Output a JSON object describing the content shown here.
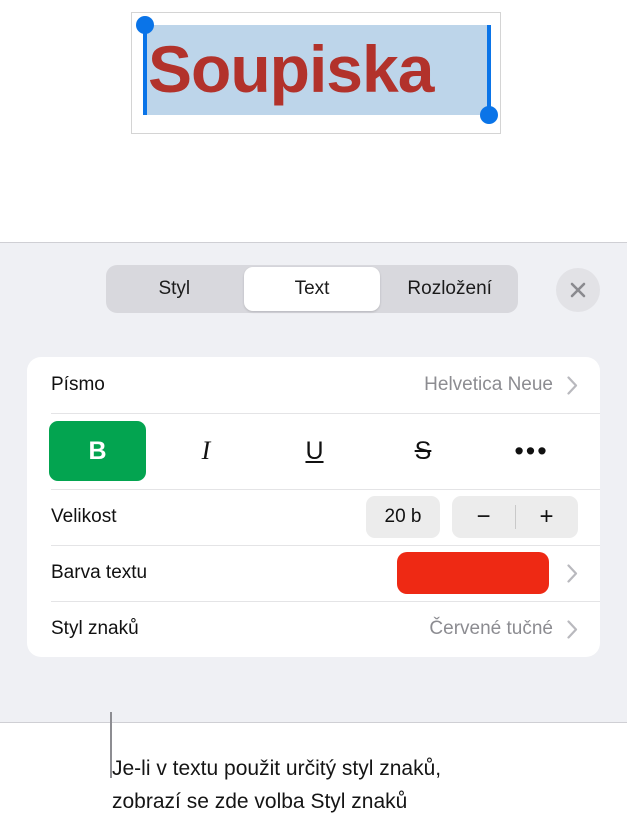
{
  "document": {
    "selected_text": "Soupiska",
    "text_color": "#b2322b",
    "selection_highlight": "#bdd5ea",
    "handle_color": "#0a74e8"
  },
  "panel": {
    "tabs": [
      {
        "label": "Styl",
        "selected": false
      },
      {
        "label": "Text",
        "selected": true
      },
      {
        "label": "Rozložení",
        "selected": false
      }
    ],
    "close_label": "×",
    "rows": {
      "font": {
        "label": "Písmo",
        "value": "Helvetica Neue"
      },
      "style_buttons": [
        {
          "name": "bold",
          "glyph": "B",
          "active": true
        },
        {
          "name": "italic",
          "glyph": "I",
          "active": false
        },
        {
          "name": "underline",
          "glyph": "U",
          "active": false
        },
        {
          "name": "strikethrough",
          "glyph": "S",
          "active": false
        },
        {
          "name": "more",
          "glyph": "•••",
          "active": false
        }
      ],
      "size": {
        "label": "Velikost",
        "value": "20 b",
        "decrement": "−",
        "increment": "+"
      },
      "text_color": {
        "label": "Barva textu",
        "swatch": "#ee2914"
      },
      "character_style": {
        "label": "Styl znaků",
        "value": "Červené tučné"
      }
    },
    "accent_active": "#03a450"
  },
  "caption": {
    "line1": "Je-li v textu použit určitý styl znaků,",
    "line2": "zobrazí se zde volba Styl znaků"
  }
}
